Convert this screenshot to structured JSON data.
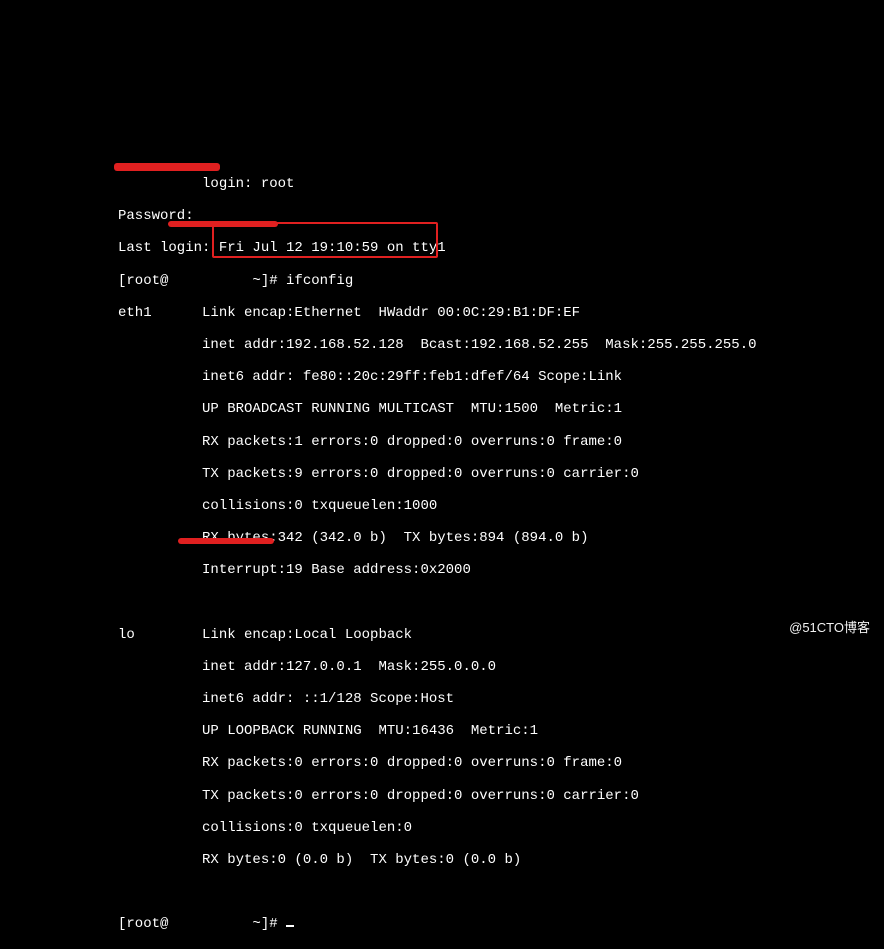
{
  "loginLine": "          login: root",
  "passwordLine": "Password:",
  "lastLogin": "Last login: Fri Jul 12 19:10:59 on tty1",
  "promptCmd": "[root@          ~]# ifconfig",
  "eth1": {
    "l1": "eth1      Link encap:Ethernet  HWaddr 00:0C:29:B1:DF:EF",
    "l2": "          inet addr:192.168.52.128  Bcast:192.168.52.255  Mask:255.255.255.0",
    "l3": "          inet6 addr: fe80::20c:29ff:feb1:dfef/64 Scope:Link",
    "l4": "          UP BROADCAST RUNNING MULTICAST  MTU:1500  Metric:1",
    "l5": "          RX packets:1 errors:0 dropped:0 overruns:0 frame:0",
    "l6": "          TX packets:9 errors:0 dropped:0 overruns:0 carrier:0",
    "l7": "          collisions:0 txqueuelen:1000",
    "l8": "          RX bytes:342 (342.0 b)  TX bytes:894 (894.0 b)",
    "l9": "          Interrupt:19 Base address:0x2000"
  },
  "lo": {
    "l1": "lo        Link encap:Local Loopback",
    "l2": "          inet addr:127.0.0.1  Mask:255.0.0.0",
    "l3": "          inet6 addr: ::1/128 Scope:Host",
    "l4": "          UP LOOPBACK RUNNING  MTU:16436  Metric:1",
    "l5": "          RX packets:0 errors:0 dropped:0 overruns:0 frame:0",
    "l6": "          TX packets:0 errors:0 dropped:0 overruns:0 carrier:0",
    "l7": "          collisions:0 txqueuelen:0",
    "l8": "          RX bytes:0 (0.0 b)  TX bytes:0 (0.0 b)"
  },
  "promptIdle": "[root@          ~]# ",
  "watermark": "@51CTO博客"
}
